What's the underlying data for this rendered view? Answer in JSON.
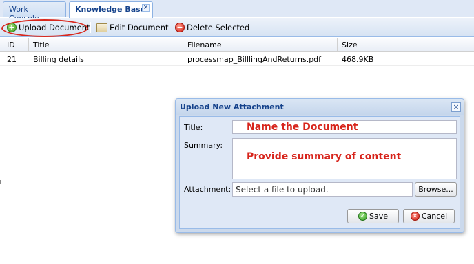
{
  "tabs": [
    {
      "label": "Work Console"
    },
    {
      "label": "Knowledge Base",
      "close": "×"
    }
  ],
  "toolbar": {
    "upload_label": "Upload Document",
    "edit_label": "Edit Document",
    "delete_label": "Delete Selected"
  },
  "grid": {
    "columns": [
      "ID",
      "Title",
      "Filename",
      "Size"
    ],
    "rows": [
      {
        "id": "21",
        "title": "Billing details",
        "filename": "processmap_BilllingAndReturns.pdf",
        "size": "468.9KB"
      }
    ]
  },
  "dialog": {
    "title": "Upload New Attachment",
    "close": "×",
    "title_label": "Title:",
    "title_value": "Name the Document",
    "summary_label": "Summary:",
    "summary_value": "Provide summary of content",
    "attachment_label": "Attachment:",
    "attachment_placeholder": "Select a file to upload.",
    "browse_label": "Browse...",
    "save_label": "Save",
    "cancel_label": "Cancel"
  },
  "colors": {
    "annotation_red": "#d7241b",
    "header_blue": "#15428b",
    "panel_blue": "#dfe8f6"
  }
}
